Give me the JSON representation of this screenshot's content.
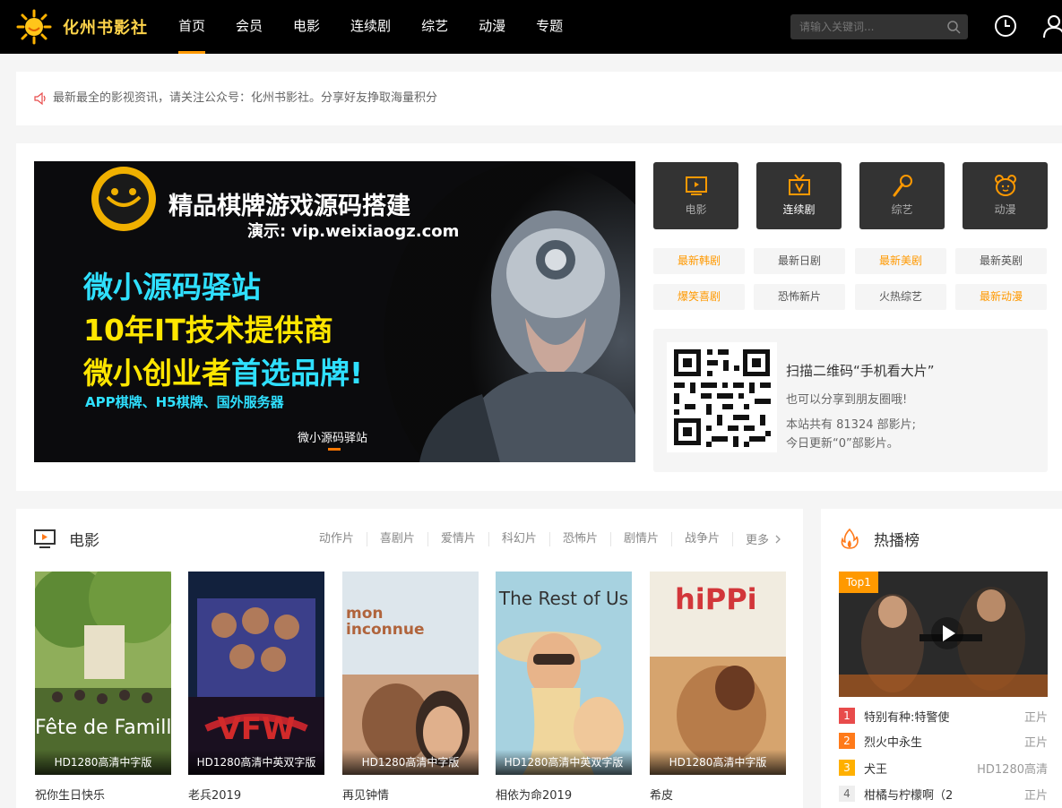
{
  "header": {
    "site_name": "化州书影社",
    "nav": [
      "首页",
      "会员",
      "电影",
      "连续剧",
      "综艺",
      "动漫",
      "专题"
    ],
    "active_nav": "首页",
    "search_placeholder": "请输入关键词..."
  },
  "notice": {
    "text": "最新最全的影视资讯，请关注公众号：化州书影社。分享好友挣取海量积分"
  },
  "banner": {
    "line1": "精品棋牌游戏源码搭建",
    "line2": "演示: vip.weixiaogz.com",
    "line3": "微小源码驿站",
    "line4": "10年IT技术提供商",
    "line5a": "微小创业者",
    "line5b": "首选品牌!",
    "line6": "APP棋牌、H5棋牌、国外服务器",
    "caption": "微小源码驿站"
  },
  "categories": [
    {
      "label": "电影",
      "icon": "tv-icon"
    },
    {
      "label": "连续剧",
      "icon": "tv-antenna-icon"
    },
    {
      "label": "综艺",
      "icon": "microphone-icon"
    },
    {
      "label": "动漫",
      "icon": "bear-icon"
    }
  ],
  "quick_tags": [
    {
      "label": "最新韩剧",
      "hot": true
    },
    {
      "label": "最新日剧",
      "hot": false
    },
    {
      "label": "最新美剧",
      "hot": true
    },
    {
      "label": "最新英剧",
      "hot": false
    },
    {
      "label": "爆笑喜剧",
      "hot": true
    },
    {
      "label": "恐怖新片",
      "hot": false
    },
    {
      "label": "火热综艺",
      "hot": false
    },
    {
      "label": "最新动漫",
      "hot": true
    }
  ],
  "qr": {
    "title": "扫描二维码“手机看大片”",
    "subtitle": "也可以分享到朋友圈哦!",
    "total": "本站共有 81324 部影片;",
    "today": "今日更新“0”部影片。"
  },
  "movies": {
    "title": "电影",
    "subnav": [
      "动作片",
      "喜剧片",
      "爱情片",
      "科幻片",
      "恐怖片",
      "剧情片",
      "战争片"
    ],
    "more": "更多",
    "items": [
      {
        "title": "祝你生日快乐",
        "quality": "HD1280高清中字版",
        "poster_text": "Fête de Famille"
      },
      {
        "title": "老兵2019",
        "quality": "HD1280高清中英双字版",
        "poster_text": "VFW"
      },
      {
        "title": "再见钟情",
        "quality": "HD1280高清中字版",
        "poster_text": "mon inconnue"
      },
      {
        "title": "相依为命2019",
        "quality": "HD1280高清中英双字版",
        "poster_text": "The Rest of Us"
      },
      {
        "title": "希皮",
        "quality": "HD1280高清中字版",
        "poster_text": "hiPPi"
      }
    ]
  },
  "hot": {
    "title": "热播榜",
    "badge": "Top1",
    "list": [
      {
        "rank": "1",
        "title": "特别有种:特警使",
        "status": "正片",
        "color": "#e84b4b"
      },
      {
        "rank": "2",
        "title": "烈火中永生",
        "status": "正片",
        "color": "#ff7a1a"
      },
      {
        "rank": "3",
        "title": "犬王",
        "status": "HD1280高清",
        "color": "#ffb000"
      },
      {
        "rank": "4",
        "title": "柑橘与柠檬啊（2",
        "status": "正片",
        "color": "#e8e8e8"
      }
    ]
  }
}
